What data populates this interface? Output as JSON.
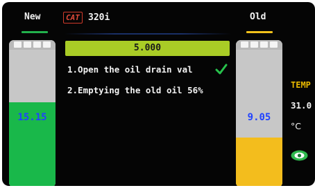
{
  "header": {
    "new_title": "New",
    "old_title": "Old",
    "brand_badge": "CAT",
    "model": "320i"
  },
  "tanks": {
    "new": {
      "value": "15.15",
      "fill_percent": 62,
      "color": "#19b84a"
    },
    "old": {
      "value": "9.05",
      "fill_percent": 36,
      "color": "#f3bd1d"
    }
  },
  "target": {
    "value": "5.000"
  },
  "steps": [
    {
      "text": "1.Open the oil drain val",
      "done": true
    },
    {
      "text": "2.Emptying the old oil 56%",
      "done": false
    }
  ],
  "temperature": {
    "label": "TEMP",
    "value": "31.0",
    "unit": "°C"
  },
  "icons": {
    "step_done": "checkmark-icon",
    "view": "eye-icon"
  },
  "colors": {
    "accent_green": "#a9cc26",
    "accent_yellow": "#e8b800",
    "value_blue": "#2143ff"
  }
}
